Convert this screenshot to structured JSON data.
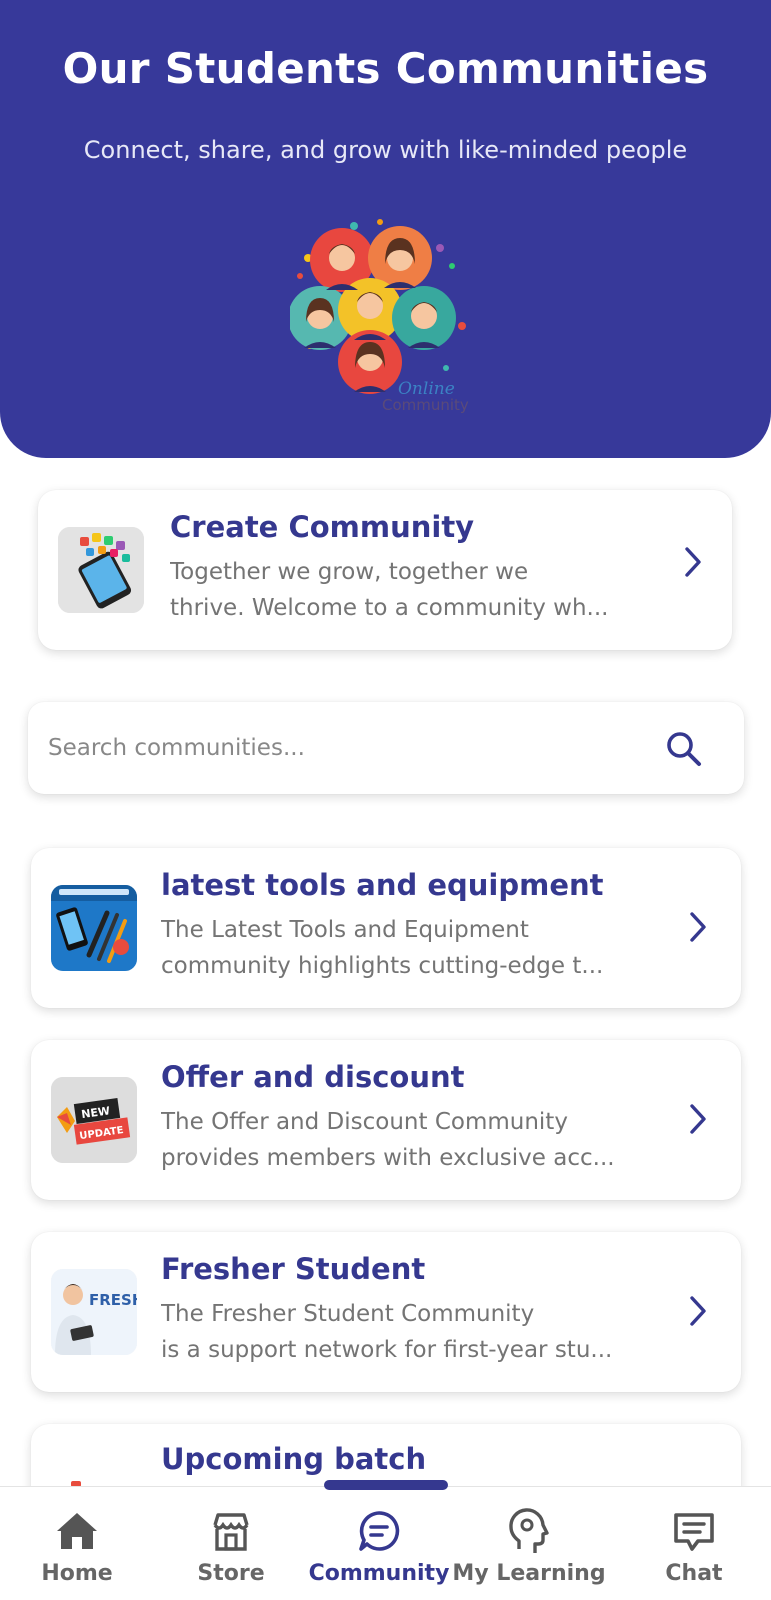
{
  "hero": {
    "title": "Our Students Communities",
    "subtitle": "Connect, share, and grow with like-minded people",
    "logo_caption_1": "Online",
    "logo_caption_2": "Community"
  },
  "create_card": {
    "title": "Create Community",
    "desc_line1": "Together we grow, together we",
    "desc_line2": "thrive. Welcome to a community wh..."
  },
  "search": {
    "placeholder": "Search communities...",
    "value": ""
  },
  "communities": [
    {
      "title": "latest tools and equipment",
      "desc_line1": "The Latest Tools and Equipment",
      "desc_line2": "community highlights cutting-edge t..."
    },
    {
      "title": "Offer and discount",
      "desc_line1": "The Offer and Discount Community",
      "desc_line2": "provides members with exclusive acc...",
      "thumb_text_1": "NEW",
      "thumb_text_2": "UPDATE"
    },
    {
      "title": "Fresher Student",
      "desc_line1": "The Fresher Student Community",
      "desc_line2": "is a support network for first-year stu...",
      "thumb_text": "FRESHE"
    },
    {
      "title": "Upcoming batch"
    }
  ],
  "bottom_nav": [
    {
      "label": "Home",
      "icon": "home-icon"
    },
    {
      "label": "Store",
      "icon": "store-icon"
    },
    {
      "label": "Community",
      "icon": "community-chat-icon",
      "active": true
    },
    {
      "label": "My Learning",
      "icon": "learning-head-icon"
    },
    {
      "label": "Chat",
      "icon": "chat-icon"
    }
  ],
  "colors": {
    "brand": "#37399a",
    "accent_text": "#35388f",
    "muted_text": "#747474"
  }
}
